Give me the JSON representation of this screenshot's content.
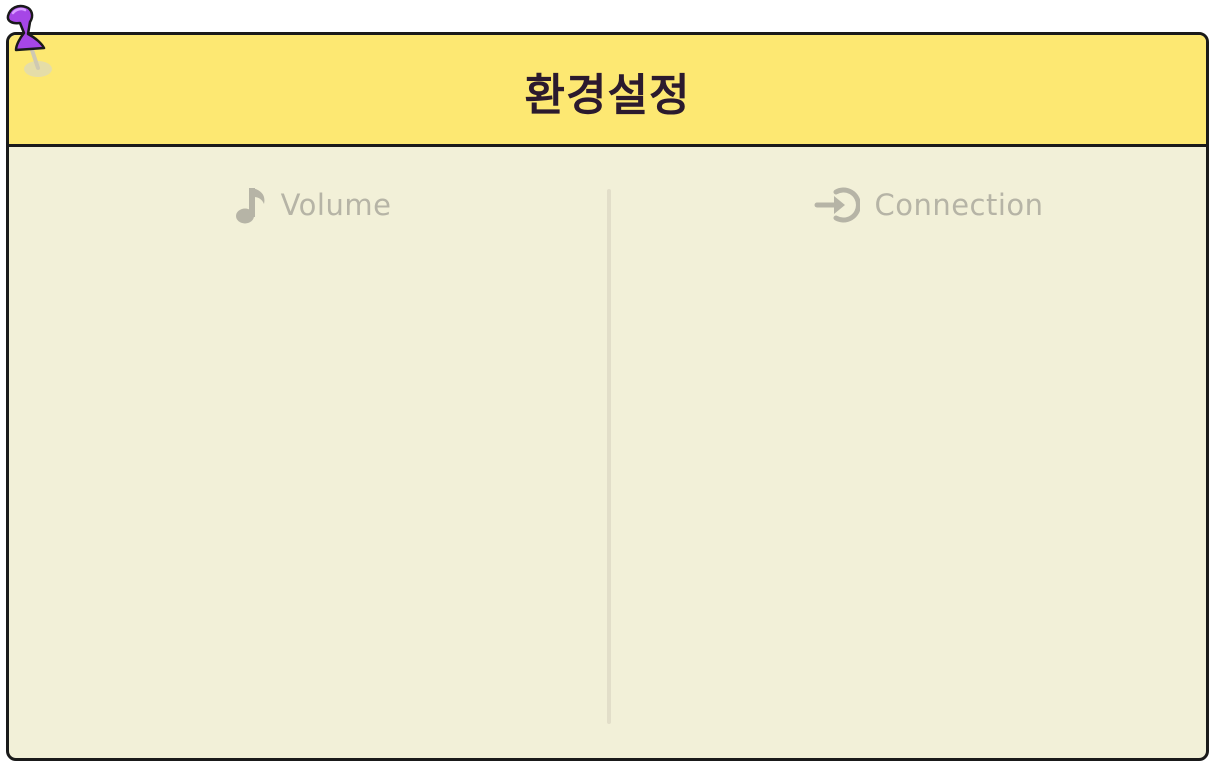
{
  "window": {
    "title": "환경설정"
  },
  "panels": {
    "volume": {
      "label": "Volume",
      "icon": "music-note-icon"
    },
    "connection": {
      "label": "Connection",
      "icon": "sign-in-icon"
    }
  },
  "colors": {
    "titlebar": "#fde872",
    "body": "#f2f0d8",
    "border": "#1a1a1a",
    "muted_text": "#b6b4a6",
    "pin": "#a646e6"
  }
}
